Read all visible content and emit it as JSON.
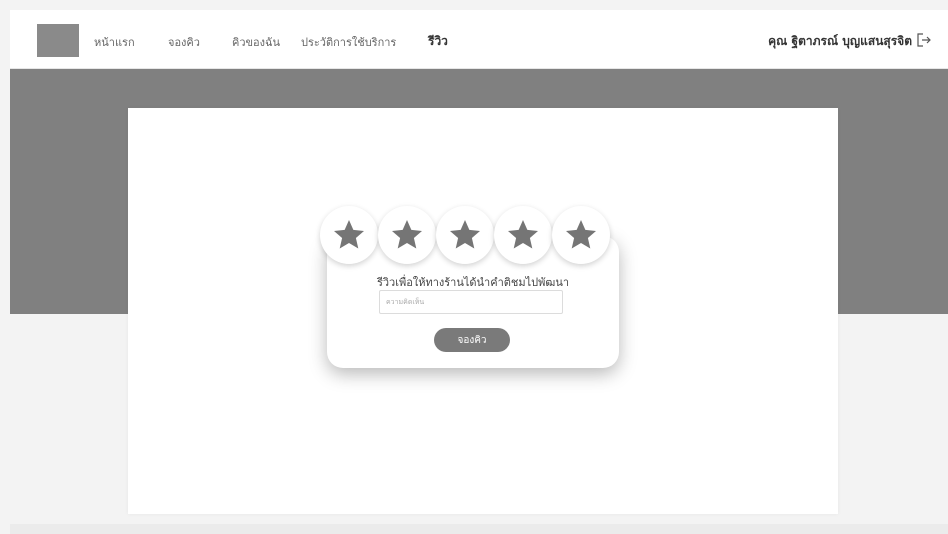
{
  "nav": {
    "items": [
      {
        "label": "หน้าแรก"
      },
      {
        "label": "จองคิว"
      },
      {
        "label": "คิวของฉัน"
      },
      {
        "label": "ประวัติการใช้บริการ"
      },
      {
        "label": "รีวิว"
      }
    ],
    "active_index": 4
  },
  "user": {
    "name": "คุณ ฐิตาภรณ์ บุญแสนสุรจิต",
    "logout_icon": "logout-icon"
  },
  "review": {
    "rating_max": 5,
    "rating": 5,
    "prompt": "รีวิวเพื่อให้ทางร้านได้นำคำติชมไปพัฒนา",
    "comment_value": "",
    "comment_placeholder": "ความคิดเห็น",
    "submit_label": "จองคิว",
    "star_icon": "star-icon"
  },
  "colors": {
    "banner": "#808080",
    "star": "#757575",
    "button": "#7a7a7a",
    "logo": "#8a8a8a"
  }
}
